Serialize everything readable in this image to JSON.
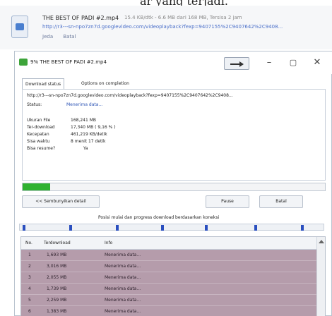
{
  "caption": "ar yang terjadi.",
  "notification": {
    "title": "THE BEST OF PADI #2.mp4",
    "meta": "15.4 KB/dtk - 6.6 MB dari 168 MB, Tersisa 2 jam",
    "url": "http://r3---sn-npo7zn7d.googlevideo.com/videoplayback?fexp=9407155%2C9407642%2C9408...",
    "actions": [
      "Jeda",
      "Batal"
    ]
  },
  "window": {
    "title": "9% THE BEST OF PADI #2.mp4",
    "controls": [
      "–",
      "▢",
      "✕"
    ]
  },
  "tabs": [
    "Download status",
    "Options on completion"
  ],
  "download": {
    "url": "http://r3---sn-npo7zn7d.googlevideo.com/videoplayback?fexp=9407155%2C9407642%2C9408...",
    "status_label": "Status:",
    "status_value": "Menerima data...",
    "fields": [
      {
        "label": "Ukuran File",
        "value": "168,241 MB"
      },
      {
        "label": "Ter-download",
        "value": "17,340 MB ( 9,16 % )"
      },
      {
        "label": "Kecepatan",
        "value": "461,219 KB/detik"
      },
      {
        "label": "Sisa waktu",
        "value": "8 menit 17 detik"
      },
      {
        "label": "Bisa resume?",
        "value": "Ya"
      }
    ],
    "progress_fraction": 0.0916
  },
  "buttons": {
    "hide_details": "<< Sembunyikan detail",
    "pause": "Pause",
    "cancel": "Batal"
  },
  "segments_caption": "Posisi mulai dan progress download berdasarkan koneksi",
  "table": {
    "headers": [
      "No.",
      "Terdownload",
      "Info"
    ],
    "rows": [
      {
        "no": "1",
        "downloaded": "1,693 MB",
        "info": "Menerima data..."
      },
      {
        "no": "2",
        "downloaded": "3,016 MB",
        "info": "Menerima data..."
      },
      {
        "no": "3",
        "downloaded": "2,055 MB",
        "info": "Menerima data..."
      },
      {
        "no": "4",
        "downloaded": "1,739 MB",
        "info": "Menerima data..."
      },
      {
        "no": "5",
        "downloaded": "2,259 MB",
        "info": "Menerima data..."
      },
      {
        "no": "6",
        "downloaded": "1,383 MB",
        "info": "Menerima data..."
      }
    ]
  },
  "colors": {
    "progress": "#30b230",
    "segment_marker": "#2a4fbf",
    "row_bg": "#b59cab"
  }
}
